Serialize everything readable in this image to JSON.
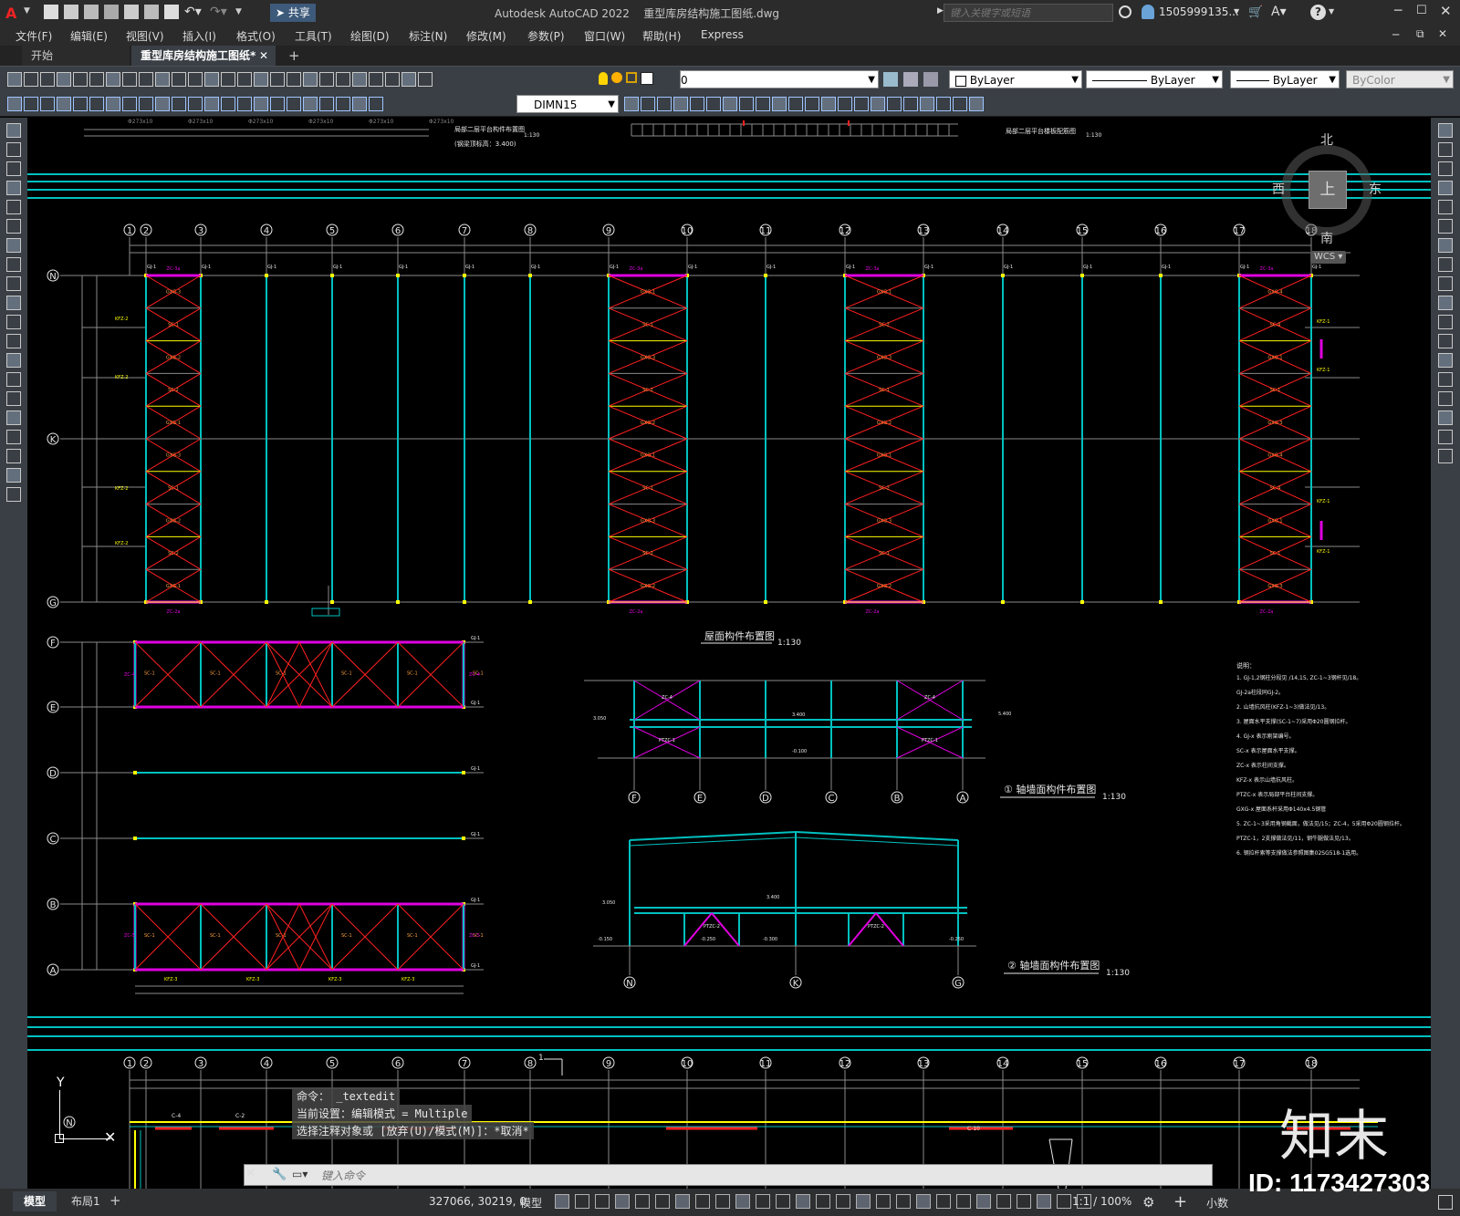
{
  "app": {
    "title": "Autodesk AutoCAD 2022",
    "filename": "重型库房结构施工图纸.dwg",
    "search_placeholder": "键入关键字或短语",
    "user": "1505999135...",
    "share_label": "共享"
  },
  "menu": [
    "文件(F)",
    "编辑(E)",
    "视图(V)",
    "插入(I)",
    "格式(O)",
    "工具(T)",
    "绘图(D)",
    "标注(N)",
    "修改(M)",
    "参数(P)",
    "窗口(W)",
    "帮助(H)",
    "Express"
  ],
  "tabs": {
    "start": "开始",
    "active": "重型库房结构施工图纸*"
  },
  "toolbar": {
    "layer_value": "0",
    "color": "ByLayer",
    "linetype": "ByLayer",
    "lineweight": "ByLayer",
    "plotstyle": "ByColor",
    "dimstyle": "DIMN15"
  },
  "viewcube": {
    "north": "北",
    "south": "南",
    "east": "东",
    "west": "西",
    "top": "上",
    "wcs": "WCS"
  },
  "drawing": {
    "grid_top": [
      "1",
      "2",
      "3",
      "4",
      "5",
      "6",
      "7",
      "8",
      "9",
      "10",
      "11",
      "12",
      "13",
      "14",
      "15",
      "16",
      "17",
      "18"
    ],
    "rows_left": [
      "N",
      "K",
      "G",
      "F",
      "E",
      "D",
      "C",
      "B",
      "A"
    ],
    "roof_title": "屋面构件布置图",
    "roof_scale": "1:130",
    "elev1_title": "① 轴墙面构件布置图",
    "elev1_scale": "1:130",
    "elev2_title": "② 轴墙面构件布置图",
    "elev2_scale": "1:130",
    "elev1_axes": [
      "F",
      "E",
      "D",
      "C",
      "B",
      "A"
    ],
    "elev2_axes": [
      "N",
      "K",
      "G"
    ],
    "top_title_left": "局部二层平台构件布置图",
    "top_subtitle_left": "(钢梁顶标高：3.400)",
    "top_scale_left": "1:130",
    "top_title_right": "局部二层平台楼板配筋图",
    "top_scale_right": "1:130",
    "elev1_levels": [
      "3.050",
      "3.400",
      "5.400",
      "-0.100"
    ],
    "elev2_levels": [
      "3.050",
      "3.400",
      "-0.150",
      "-0.250",
      "-0.300",
      "-0.250"
    ],
    "notes_title": "说明：",
    "notes": [
      "1. GJ-1,2钢柱分段见 /14,15, ZC-1~3钢杆见/18。",
      "   GJ-2a柱段同GJ-2。",
      "2. 山墙抗风柱(KFZ-1~3)做法见/13。",
      "3. 屋面水平支撑(SC-1~7)采用Φ20圆钢拉杆。",
      "4. GJ-x  表示刚架编号。",
      "   SC-x  表示屋面水平支撑。",
      "   ZC-x  表示柱间支撑。",
      "   KFZ-x  表示山墙抗风柱。",
      "   PTZC-x  表示局部平台柱间支撑。",
      "   GXG-x  屋面系杆采用Φ140x4.5钢管",
      "5. ZC-1~3采用角钢截面，做法见/15；ZC-4，5采用Φ20圆钢拉杆。",
      "   PTZC-1，2支撑做法见/11，钢牛腿做法见/13。",
      "6. 钢拉杆索等支撑做法参照图集02SG518-1选用。"
    ],
    "labels": {
      "GXG3": "GXG-3",
      "GXG2": "GXG-2",
      "SC1": "SC-1",
      "SC2": "SC-2",
      "GXG1": "GXG-1",
      "ZC3a": "ZC-3a",
      "ZC2a": "ZC-2a",
      "GJ1": "GJ-1",
      "GJ2": "GJ-2",
      "KFZ1": "KFZ-1",
      "KFZ2": "KFZ-2",
      "KFZ3": "KFZ-3",
      "ZC4": "ZC-4",
      "ZC5": "ZC-5",
      "PTZC1": "PTZC-1",
      "PTZC2": "PTZC-2",
      "C4": "C-4",
      "C2": "C-2",
      "C10": "C-10",
      "GXG4": "GXG-4",
      "SC4": "SC-4"
    }
  },
  "command": {
    "line1": "命令：  _textedit",
    "line2": "当前设置：编辑模式 = Multiple",
    "line3": "选择注释对象或 [放弃(U)/模式(M)]：*取消*",
    "input_placeholder": "键入命令"
  },
  "status": {
    "coords": "327066, 30219, 0",
    "mode": "模型",
    "scale": "1:1 / 100%",
    "units": "小数",
    "layout_tabs": [
      "模型",
      "布局1"
    ]
  },
  "watermark": {
    "logo": "知末",
    "id": "ID: 1173427303"
  },
  "colors": {
    "cyan": "#00c0c0",
    "red": "#ff2020",
    "magenta": "#e000e0",
    "yellow": "#ffff00",
    "white": "#e8e8e8",
    "grey": "#8a8a8a",
    "orange": "#ffa040"
  }
}
